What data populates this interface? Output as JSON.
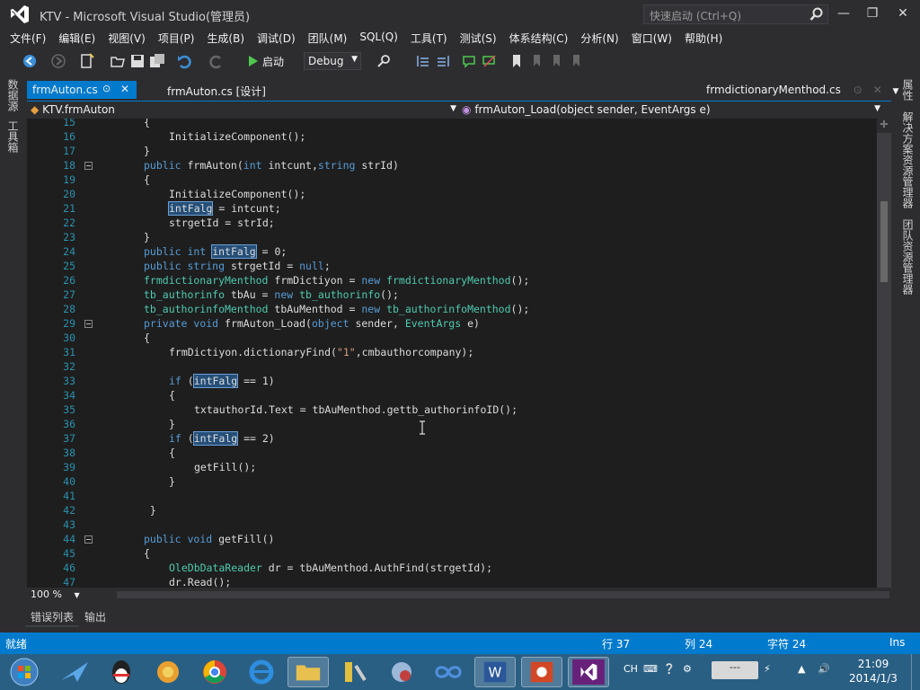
{
  "window": {
    "title": "KTV - Microsoft Visual Studio(管理员)",
    "quick_launch_placeholder": "快速启动 (Ctrl+Q)"
  },
  "menu": [
    "文件(F)",
    "编辑(E)",
    "视图(V)",
    "项目(P)",
    "生成(B)",
    "调试(D)",
    "团队(M)",
    "SQL(Q)",
    "工具(T)",
    "测试(S)",
    "体系结构(C)",
    "分析(N)",
    "窗口(W)",
    "帮助(H)"
  ],
  "toolbar": {
    "start_label": "启动",
    "config_value": "Debug"
  },
  "left_panels": [
    "数据源",
    "工具箱"
  ],
  "right_panels": [
    "属性",
    "解决方案资源管理器",
    "团队资源管理器"
  ],
  "tabs": {
    "active": "frmAuton.cs",
    "design": "frmAuton.cs [设计]",
    "right": "frmdictionaryMenthod.cs"
  },
  "nav": {
    "class": "KTV.frmAuton",
    "member": "frmAuton_Load(object sender, EventArgs e)"
  },
  "code": [
    {
      "n": "15",
      "segs": [
        {
          "t": "{",
          "c": ""
        }
      ],
      "indent": 0
    },
    {
      "n": "16",
      "segs": [
        {
          "t": "InitializeComponent();",
          "c": ""
        }
      ],
      "indent": 1
    },
    {
      "n": "17",
      "segs": [
        {
          "t": "}",
          "c": ""
        }
      ],
      "indent": 0
    },
    {
      "n": "18",
      "fold": true,
      "segs": [
        {
          "t": "public",
          "c": "kw"
        },
        {
          "t": " frmAuton(",
          "c": ""
        },
        {
          "t": "int",
          "c": "kw"
        },
        {
          "t": " intcunt,",
          "c": ""
        },
        {
          "t": "string",
          "c": "kw"
        },
        {
          "t": " strId)",
          "c": ""
        }
      ],
      "indent": 0
    },
    {
      "n": "19",
      "segs": [
        {
          "t": "{",
          "c": ""
        }
      ],
      "indent": 0
    },
    {
      "n": "20",
      "segs": [
        {
          "t": "InitializeComponent();",
          "c": ""
        }
      ],
      "indent": 1
    },
    {
      "n": "21",
      "segs": [
        {
          "t": "intFalg",
          "c": "hl"
        },
        {
          "t": " = intcunt;",
          "c": ""
        }
      ],
      "indent": 1
    },
    {
      "n": "22",
      "segs": [
        {
          "t": "strgetId = strId;",
          "c": ""
        }
      ],
      "indent": 1
    },
    {
      "n": "23",
      "segs": [
        {
          "t": "}",
          "c": ""
        }
      ],
      "indent": 0
    },
    {
      "n": "24",
      "segs": [
        {
          "t": "public",
          "c": "kw"
        },
        {
          "t": " ",
          "c": ""
        },
        {
          "t": "int",
          "c": "kw"
        },
        {
          "t": " ",
          "c": ""
        },
        {
          "t": "intFalg",
          "c": "hl"
        },
        {
          "t": " = 0;",
          "c": ""
        }
      ],
      "indent": 0
    },
    {
      "n": "25",
      "segs": [
        {
          "t": "public",
          "c": "kw"
        },
        {
          "t": " ",
          "c": ""
        },
        {
          "t": "string",
          "c": "kw"
        },
        {
          "t": " strgetId = ",
          "c": ""
        },
        {
          "t": "null",
          "c": "kw"
        },
        {
          "t": ";",
          "c": ""
        }
      ],
      "indent": 0
    },
    {
      "n": "26",
      "segs": [
        {
          "t": "frmdictionaryMenthod",
          "c": "ty"
        },
        {
          "t": " frmDictiyon = ",
          "c": ""
        },
        {
          "t": "new",
          "c": "kw"
        },
        {
          "t": " ",
          "c": ""
        },
        {
          "t": "frmdictionaryMenthod",
          "c": "ty"
        },
        {
          "t": "();",
          "c": ""
        }
      ],
      "indent": 0
    },
    {
      "n": "27",
      "segs": [
        {
          "t": "tb_authorinfo",
          "c": "ty"
        },
        {
          "t": " tbAu = ",
          "c": ""
        },
        {
          "t": "new",
          "c": "kw"
        },
        {
          "t": " ",
          "c": ""
        },
        {
          "t": "tb_authorinfo",
          "c": "ty"
        },
        {
          "t": "();",
          "c": ""
        }
      ],
      "indent": 0
    },
    {
      "n": "28",
      "segs": [
        {
          "t": "tb_authorinfoMenthod",
          "c": "ty"
        },
        {
          "t": " tbAuMenthod = ",
          "c": ""
        },
        {
          "t": "new",
          "c": "kw"
        },
        {
          "t": " ",
          "c": ""
        },
        {
          "t": "tb_authorinfoMenthod",
          "c": "ty"
        },
        {
          "t": "();",
          "c": ""
        }
      ],
      "indent": 0
    },
    {
      "n": "29",
      "fold": true,
      "segs": [
        {
          "t": "private",
          "c": "kw"
        },
        {
          "t": " ",
          "c": ""
        },
        {
          "t": "void",
          "c": "kw"
        },
        {
          "t": " frmAuton_Load(",
          "c": ""
        },
        {
          "t": "object",
          "c": "kw"
        },
        {
          "t": " sender, ",
          "c": ""
        },
        {
          "t": "EventArgs",
          "c": "ty"
        },
        {
          "t": " e)",
          "c": ""
        }
      ],
      "indent": 0
    },
    {
      "n": "30",
      "segs": [
        {
          "t": "{",
          "c": ""
        }
      ],
      "indent": 0
    },
    {
      "n": "31",
      "segs": [
        {
          "t": "frmDictiyon.dictionaryFind(",
          "c": ""
        },
        {
          "t": "\"1\"",
          "c": "str"
        },
        {
          "t": ",cmbauthorcompany);",
          "c": ""
        }
      ],
      "indent": 1
    },
    {
      "n": "32",
      "segs": [
        {
          "t": "",
          "c": ""
        }
      ],
      "indent": 0
    },
    {
      "n": "33",
      "segs": [
        {
          "t": "if",
          "c": "kw"
        },
        {
          "t": " (",
          "c": ""
        },
        {
          "t": "intFalg",
          "c": "hl"
        },
        {
          "t": " == 1)",
          "c": ""
        }
      ],
      "indent": 1
    },
    {
      "n": "34",
      "segs": [
        {
          "t": "{",
          "c": ""
        }
      ],
      "indent": 1
    },
    {
      "n": "35",
      "segs": [
        {
          "t": "txtauthorId.Text = tbAuMenthod.gettb_authorinfoID();",
          "c": ""
        }
      ],
      "indent": 2
    },
    {
      "n": "36",
      "segs": [
        {
          "t": "}",
          "c": ""
        }
      ],
      "indent": 1
    },
    {
      "n": "37",
      "segs": [
        {
          "t": "if",
          "c": "kw"
        },
        {
          "t": " (",
          "c": ""
        },
        {
          "t": "intFalg",
          "c": "hl"
        },
        {
          "t": " == 2)",
          "c": ""
        }
      ],
      "indent": 1
    },
    {
      "n": "38",
      "segs": [
        {
          "t": "{",
          "c": ""
        }
      ],
      "indent": 1
    },
    {
      "n": "39",
      "segs": [
        {
          "t": "getFill();",
          "c": ""
        }
      ],
      "indent": 2
    },
    {
      "n": "40",
      "segs": [
        {
          "t": "}",
          "c": ""
        }
      ],
      "indent": 1
    },
    {
      "n": "41",
      "segs": [
        {
          "t": "",
          "c": ""
        }
      ],
      "indent": 0
    },
    {
      "n": "42",
      "segs": [
        {
          "t": " }",
          "c": ""
        }
      ],
      "indent": 0
    },
    {
      "n": "43",
      "segs": [
        {
          "t": "",
          "c": ""
        }
      ],
      "indent": 0
    },
    {
      "n": "44",
      "fold": true,
      "segs": [
        {
          "t": "public",
          "c": "kw"
        },
        {
          "t": " ",
          "c": ""
        },
        {
          "t": "void",
          "c": "kw"
        },
        {
          "t": " getFill()",
          "c": ""
        }
      ],
      "indent": 0
    },
    {
      "n": "45",
      "segs": [
        {
          "t": "{",
          "c": ""
        }
      ],
      "indent": 0
    },
    {
      "n": "46",
      "segs": [
        {
          "t": "OleDbDataReader",
          "c": "ty"
        },
        {
          "t": " dr = tbAuMenthod.AuthFind(strgetId);",
          "c": ""
        }
      ],
      "indent": 1
    },
    {
      "n": "47",
      "segs": [
        {
          "t": "dr.Read();",
          "c": ""
        }
      ],
      "indent": 1
    }
  ],
  "zoom": "100 %",
  "panel_tabs": [
    "错误列表",
    "输出"
  ],
  "status": {
    "ready": "就绪",
    "row": "行 37",
    "col": "列 24",
    "char": "字符 24",
    "mode": "Ins"
  },
  "taskbar": {
    "lang": "CH",
    "time": "21:09",
    "date": "2014/1/3",
    "tray_box": "---"
  },
  "colors": {
    "accent": "#007acc",
    "background": "#2d2d30",
    "editor": "#1e1e1e"
  }
}
